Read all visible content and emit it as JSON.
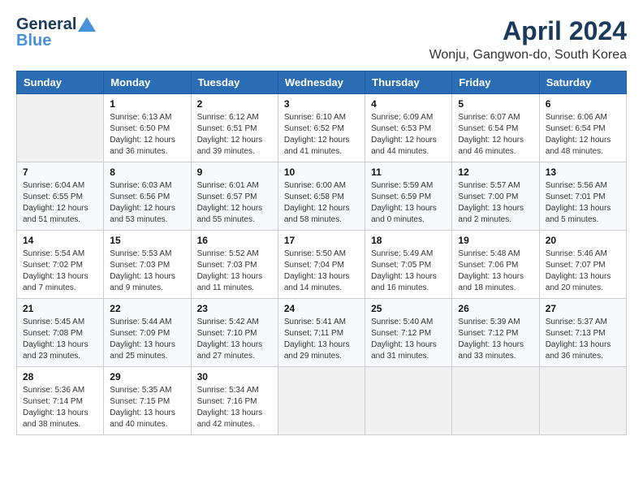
{
  "header": {
    "logo_general": "General",
    "logo_blue": "Blue",
    "month_title": "April 2024",
    "location": "Wonju, Gangwon-do, South Korea"
  },
  "days_of_week": [
    "Sunday",
    "Monday",
    "Tuesday",
    "Wednesday",
    "Thursday",
    "Friday",
    "Saturday"
  ],
  "weeks": [
    [
      {
        "day": "",
        "empty": true
      },
      {
        "day": "1",
        "sunrise": "6:13 AM",
        "sunset": "6:50 PM",
        "daylight": "12 hours and 36 minutes."
      },
      {
        "day": "2",
        "sunrise": "6:12 AM",
        "sunset": "6:51 PM",
        "daylight": "12 hours and 39 minutes."
      },
      {
        "day": "3",
        "sunrise": "6:10 AM",
        "sunset": "6:52 PM",
        "daylight": "12 hours and 41 minutes."
      },
      {
        "day": "4",
        "sunrise": "6:09 AM",
        "sunset": "6:53 PM",
        "daylight": "12 hours and 44 minutes."
      },
      {
        "day": "5",
        "sunrise": "6:07 AM",
        "sunset": "6:54 PM",
        "daylight": "12 hours and 46 minutes."
      },
      {
        "day": "6",
        "sunrise": "6:06 AM",
        "sunset": "6:54 PM",
        "daylight": "12 hours and 48 minutes."
      }
    ],
    [
      {
        "day": "7",
        "sunrise": "6:04 AM",
        "sunset": "6:55 PM",
        "daylight": "12 hours and 51 minutes."
      },
      {
        "day": "8",
        "sunrise": "6:03 AM",
        "sunset": "6:56 PM",
        "daylight": "12 hours and 53 minutes."
      },
      {
        "day": "9",
        "sunrise": "6:01 AM",
        "sunset": "6:57 PM",
        "daylight": "12 hours and 55 minutes."
      },
      {
        "day": "10",
        "sunrise": "6:00 AM",
        "sunset": "6:58 PM",
        "daylight": "12 hours and 58 minutes."
      },
      {
        "day": "11",
        "sunrise": "5:59 AM",
        "sunset": "6:59 PM",
        "daylight": "13 hours and 0 minutes."
      },
      {
        "day": "12",
        "sunrise": "5:57 AM",
        "sunset": "7:00 PM",
        "daylight": "13 hours and 2 minutes."
      },
      {
        "day": "13",
        "sunrise": "5:56 AM",
        "sunset": "7:01 PM",
        "daylight": "13 hours and 5 minutes."
      }
    ],
    [
      {
        "day": "14",
        "sunrise": "5:54 AM",
        "sunset": "7:02 PM",
        "daylight": "13 hours and 7 minutes."
      },
      {
        "day": "15",
        "sunrise": "5:53 AM",
        "sunset": "7:03 PM",
        "daylight": "13 hours and 9 minutes."
      },
      {
        "day": "16",
        "sunrise": "5:52 AM",
        "sunset": "7:03 PM",
        "daylight": "13 hours and 11 minutes."
      },
      {
        "day": "17",
        "sunrise": "5:50 AM",
        "sunset": "7:04 PM",
        "daylight": "13 hours and 14 minutes."
      },
      {
        "day": "18",
        "sunrise": "5:49 AM",
        "sunset": "7:05 PM",
        "daylight": "13 hours and 16 minutes."
      },
      {
        "day": "19",
        "sunrise": "5:48 AM",
        "sunset": "7:06 PM",
        "daylight": "13 hours and 18 minutes."
      },
      {
        "day": "20",
        "sunrise": "5:46 AM",
        "sunset": "7:07 PM",
        "daylight": "13 hours and 20 minutes."
      }
    ],
    [
      {
        "day": "21",
        "sunrise": "5:45 AM",
        "sunset": "7:08 PM",
        "daylight": "13 hours and 23 minutes."
      },
      {
        "day": "22",
        "sunrise": "5:44 AM",
        "sunset": "7:09 PM",
        "daylight": "13 hours and 25 minutes."
      },
      {
        "day": "23",
        "sunrise": "5:42 AM",
        "sunset": "7:10 PM",
        "daylight": "13 hours and 27 minutes."
      },
      {
        "day": "24",
        "sunrise": "5:41 AM",
        "sunset": "7:11 PM",
        "daylight": "13 hours and 29 minutes."
      },
      {
        "day": "25",
        "sunrise": "5:40 AM",
        "sunset": "7:12 PM",
        "daylight": "13 hours and 31 minutes."
      },
      {
        "day": "26",
        "sunrise": "5:39 AM",
        "sunset": "7:12 PM",
        "daylight": "13 hours and 33 minutes."
      },
      {
        "day": "27",
        "sunrise": "5:37 AM",
        "sunset": "7:13 PM",
        "daylight": "13 hours and 36 minutes."
      }
    ],
    [
      {
        "day": "28",
        "sunrise": "5:36 AM",
        "sunset": "7:14 PM",
        "daylight": "13 hours and 38 minutes."
      },
      {
        "day": "29",
        "sunrise": "5:35 AM",
        "sunset": "7:15 PM",
        "daylight": "13 hours and 40 minutes."
      },
      {
        "day": "30",
        "sunrise": "5:34 AM",
        "sunset": "7:16 PM",
        "daylight": "13 hours and 42 minutes."
      },
      {
        "day": "",
        "empty": true
      },
      {
        "day": "",
        "empty": true
      },
      {
        "day": "",
        "empty": true
      },
      {
        "day": "",
        "empty": true
      }
    ]
  ],
  "labels": {
    "sunrise": "Sunrise:",
    "sunset": "Sunset:",
    "daylight": "Daylight:"
  }
}
